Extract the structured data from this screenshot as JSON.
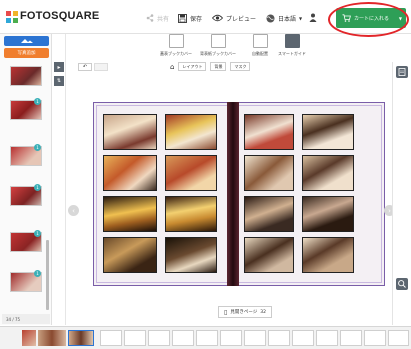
{
  "app": {
    "name": "FOTOSQUARE"
  },
  "header": {
    "share_label": "共有",
    "save_label": "保存",
    "preview_label": "プレビュー",
    "language_label": "日本語",
    "cart_label": "カートに入れる",
    "accent": "#2e9f57",
    "annotation_color": "#e2262a"
  },
  "left_panel": {
    "primary_button_color": "#2c74d2",
    "secondary_button_label": "写真追加",
    "secondary_button_color": "#f07e2e",
    "photos_count_label": "34 / 75"
  },
  "toolbar": {
    "tools": [
      {
        "label": "蓋表ブックカバー"
      },
      {
        "label": "背表紙ブックカバー"
      },
      {
        "label": "自動配置"
      },
      {
        "label": "スマートガイド"
      }
    ],
    "sub_buttons": [
      {
        "label": "レイアウト"
      },
      {
        "label": "背景"
      },
      {
        "label": "マスク"
      }
    ]
  },
  "canvas": {
    "page_label": "見開きページ",
    "page_number": "32",
    "prev_icon": "chevron-left-icon",
    "next_icon": "chevron-right-icon",
    "frame_color": "#7a5ea8"
  },
  "colors": {
    "badge": "#3bb0b7",
    "spine": "#3a1018"
  }
}
